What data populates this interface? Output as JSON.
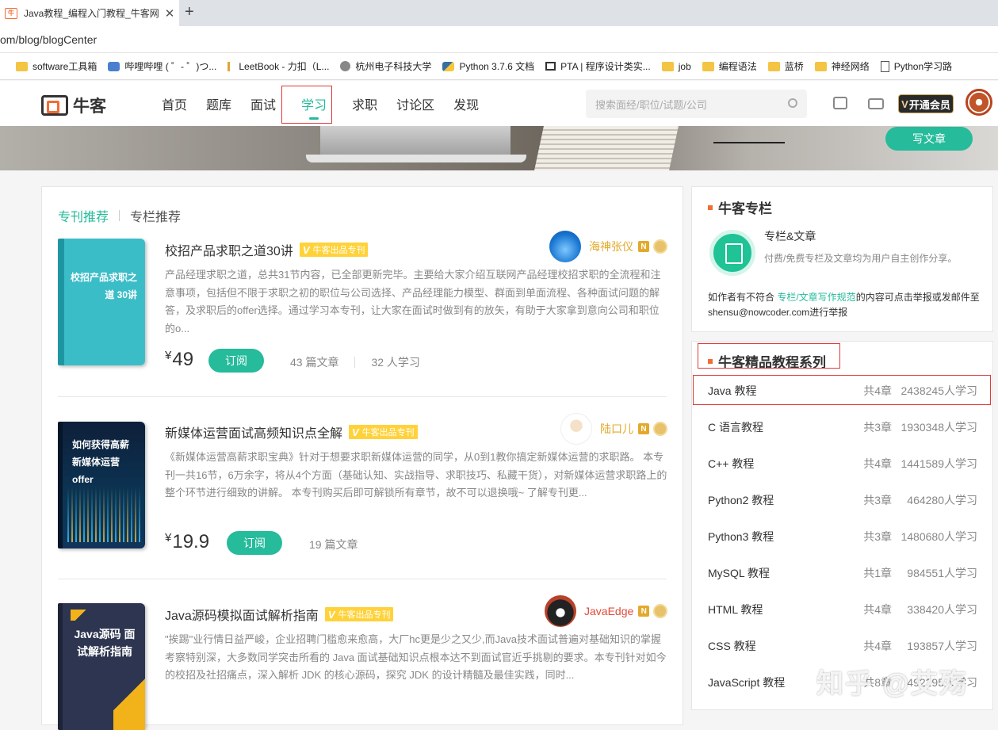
{
  "browser": {
    "tab_title": "Java教程_编程入门教程_牛客网",
    "tab_close": "✕",
    "new_tab": "+",
    "url": "om/blog/blogCenter",
    "bookmarks": [
      {
        "label": "software工具箱",
        "icon": "folder-icon"
      },
      {
        "label": "哔哩哔哩 ( ゜- ゜)つ...",
        "icon": "bilibili-icon"
      },
      {
        "label": "LeetBook - 力扣（L...",
        "icon": "leetcode-icon"
      },
      {
        "label": "杭州电子科技大学",
        "icon": "university-icon"
      },
      {
        "label": "Python 3.7.6 文档",
        "icon": "python-icon"
      },
      {
        "label": "PTA | 程序设计类实...",
        "icon": "pta-icon"
      },
      {
        "label": "job",
        "icon": "folder-icon"
      },
      {
        "label": "编程语法",
        "icon": "folder-icon"
      },
      {
        "label": "蓝桥",
        "icon": "folder-icon"
      },
      {
        "label": "神经网络",
        "icon": "folder-icon"
      },
      {
        "label": "Python学习路",
        "icon": "document-icon"
      }
    ]
  },
  "header": {
    "logo_text": "牛客",
    "nav": [
      {
        "label": "首页",
        "active": false
      },
      {
        "label": "题库",
        "active": false
      },
      {
        "label": "面试",
        "active": false
      },
      {
        "label": "学习",
        "active": true
      },
      {
        "label": "求职",
        "active": false
      },
      {
        "label": "讨论区",
        "active": false
      },
      {
        "label": "发现",
        "active": false
      }
    ],
    "search_placeholder": "搜索面经/职位/试题/公司",
    "vip_label": "开通会员",
    "vip_v": "V"
  },
  "banner": {
    "write_button": "写文章"
  },
  "main": {
    "tabs": [
      "专刊推荐",
      "专栏推荐"
    ],
    "columns": [
      {
        "cover_text": "校招产品求职之道 30讲",
        "title": "校招产品求职之道30讲",
        "badge": "牛客出品专刊",
        "author": "海神张仪",
        "desc": "产品经理求职之道，总共31节内容，已全部更新完毕。主要给大家介绍互联网产品经理校招求职的全流程和注意事项，包括但不限于求职之初的职位与公司选择、产品经理能力模型、群面到单面流程、各种面试问题的解答，及求职后的offer选择。通过学习本专刊，让大家在面试时做到有的放矢，有助于大家拿到意向公司和职位的o...",
        "currency": "¥",
        "price": "49",
        "subscribe": "订阅",
        "articles": "43 篇文章",
        "learners": "32 人学习"
      },
      {
        "cover_text": "如何获得高薪 新媒体运营offer",
        "title": "新媒体运营面试高频知识点全解",
        "badge": "牛客出品专刊",
        "author": "陆口儿",
        "desc": "《新媒体运营高薪求职宝典》针对于想要求职新媒体运营的同学，从0到1教你搞定新媒体运营的求职路。 本专刊一共16节，6万余字，将从4个方面（基础认知、实战指导、求职技巧、私藏干货），对新媒体运营求职路上的整个环节进行细致的讲解。 本专刊购买后即可解锁所有章节，故不可以退换哦~ 了解专刊更...",
        "currency": "¥",
        "price": "19.9",
        "subscribe": "订阅",
        "articles": "19 篇文章",
        "learners": ""
      },
      {
        "cover_text": "Java源码 面试解析指南",
        "title": "Java源码模拟面试解析指南",
        "badge": "牛客出品专刊",
        "author": "JavaEdge",
        "desc": "\"挨踢\"业行情日益严峻，企业招聘门槛愈来愈高，大厂hc更是少之又少,而Java技术面试普遍对基础知识的掌握考察特别深，大多数同学突击所看的 Java 面试基础知识点根本达不到面试官近乎挑剔的要求。本专刊针对如今的校招及社招痛点，深入解析 JDK 的核心源码，探究 JDK 的设计精髓及最佳实践，同时..."
      }
    ],
    "n_badge": "N"
  },
  "sidebar": {
    "column_card": {
      "heading": "牛客专栏",
      "title": "专栏&文章",
      "subtitle": "付费/免费专栏及文章均为用户自主创作分享。",
      "note_prefix": "如作者有不符合 ",
      "note_link": "专栏/文章写作规范",
      "note_suffix": "的内容可点击举报或发邮件至shensu@nowcoder.com进行举报"
    },
    "tutorial_card": {
      "heading": "牛客精品教程系列",
      "items": [
        {
          "name": "Java 教程",
          "chapters": "共4章",
          "learners": "2438245人学习"
        },
        {
          "name": "C 语言教程",
          "chapters": "共3章",
          "learners": "1930348人学习"
        },
        {
          "name": "C++ 教程",
          "chapters": "共4章",
          "learners": "1441589人学习"
        },
        {
          "name": "Python2 教程",
          "chapters": "共3章",
          "learners": "464280人学习"
        },
        {
          "name": "Python3 教程",
          "chapters": "共3章",
          "learners": "1480680人学习"
        },
        {
          "name": "MySQL 教程",
          "chapters": "共1章",
          "learners": "984551人学习"
        },
        {
          "name": "HTML 教程",
          "chapters": "共4章",
          "learners": "338420人学习"
        },
        {
          "name": "CSS 教程",
          "chapters": "共4章",
          "learners": "193857人学习"
        },
        {
          "name": "JavaScript 教程",
          "chapters": "共8章",
          "learners": "492295人学习"
        }
      ]
    }
  },
  "watermark": "知乎 @艾殇",
  "colors": {
    "accent": "#25bb9b",
    "badge": "#ffd23a",
    "highlight": "#e03a3a",
    "brand_orange": "#f36c35"
  }
}
